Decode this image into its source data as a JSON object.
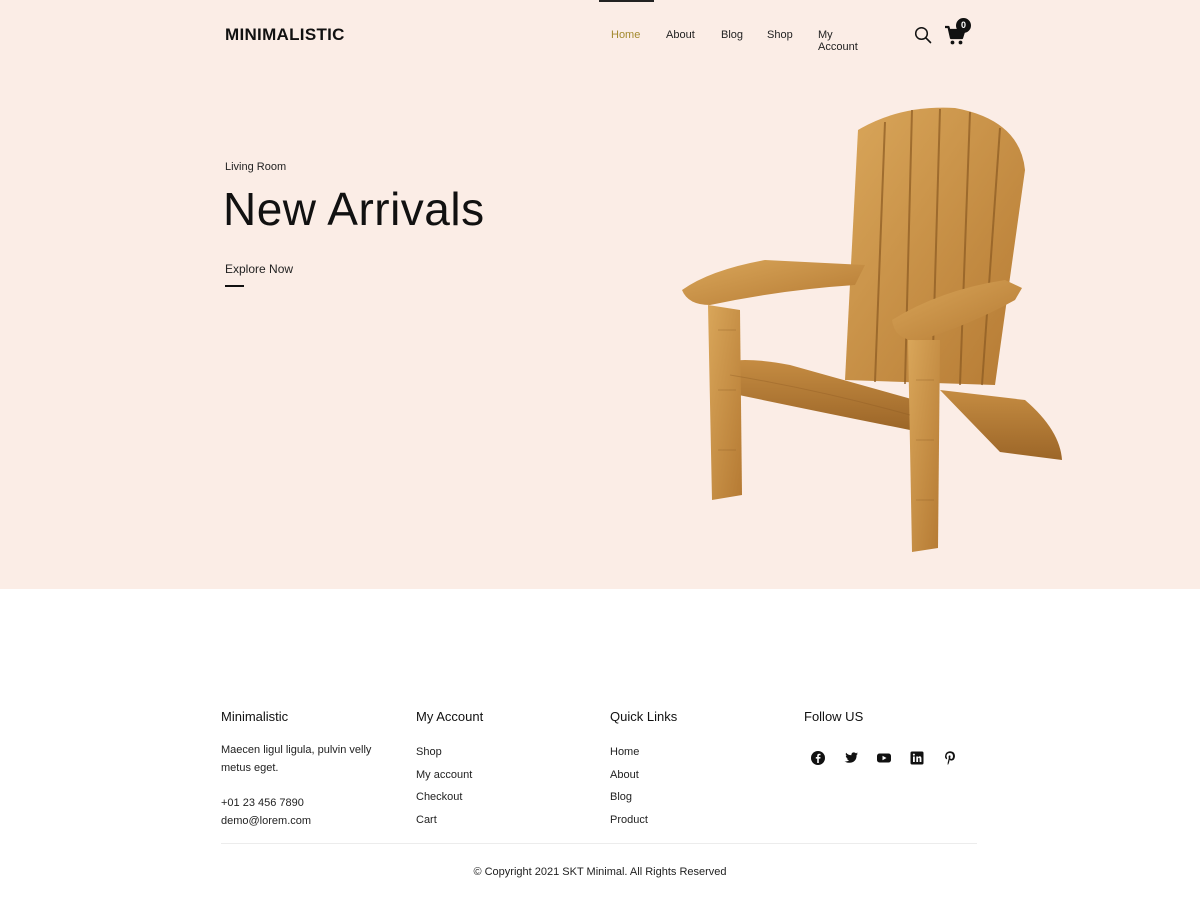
{
  "header": {
    "logo": "MINIMALISTIC",
    "nav": [
      {
        "label": "Home",
        "active": true
      },
      {
        "label": "About",
        "active": false
      },
      {
        "label": "Blog",
        "active": false
      },
      {
        "label": "Shop",
        "active": false
      },
      {
        "label": "My Account",
        "active": false
      }
    ],
    "cart_count": "0",
    "icons": [
      "search-icon",
      "cart-icon"
    ]
  },
  "hero": {
    "kicker": "Living Room",
    "title": "New Arrivals",
    "cta": "Explore Now",
    "image": "adirondack-chair"
  },
  "footer": {
    "col1": {
      "title": "Minimalistic",
      "text_line1": "Maecen ligul ligula, pulvin velly",
      "text_line2": "metus eget.",
      "phone": "+01 23 456 7890",
      "email": "demo@lorem.com"
    },
    "col2": {
      "title": "My Account",
      "links": [
        "Shop",
        "My account",
        "Checkout",
        "Cart"
      ]
    },
    "col3": {
      "title": "Quick Links",
      "links": [
        "Home",
        "About",
        "Blog",
        "Product"
      ]
    },
    "col4": {
      "title": "Follow US",
      "social": [
        "facebook-icon",
        "twitter-icon",
        "youtube-icon",
        "linkedin-icon",
        "pinterest-icon"
      ]
    },
    "copyright": "© Copyright 2021 SKT Minimal. All Rights Reserved"
  },
  "colors": {
    "hero_bg": "#fbede6",
    "accent": "#a38a2e",
    "text": "#111111"
  }
}
